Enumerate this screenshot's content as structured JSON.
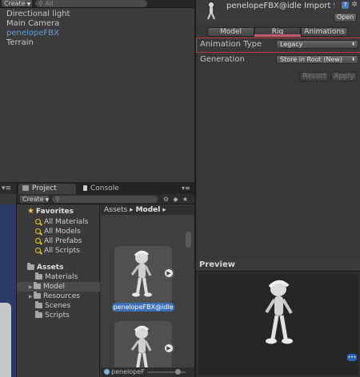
{
  "hierarchy": {
    "create_label": "Create",
    "search_placeholder": "All",
    "items": [
      "Directional light",
      "Main Camera",
      "penelopeFBX",
      "Terrain"
    ]
  },
  "scene": {
    "tab_label": ""
  },
  "project": {
    "tab_project": "Project",
    "tab_console": "Console",
    "create_label": "Create",
    "favorites": {
      "title": "Favorites",
      "items": [
        "All Materials",
        "All Models",
        "All Prefabs",
        "All Scripts"
      ]
    },
    "assets": {
      "title": "Assets",
      "folders": [
        "Materials",
        "Model",
        "Resources",
        "Scenes",
        "Scripts"
      ]
    },
    "breadcrumb": {
      "root": "Assets",
      "sep": "▸",
      "current": "Model",
      "end": "▸"
    },
    "thumbnails": [
      {
        "label": "penelopeFBX@idle"
      },
      {
        "label": ""
      }
    ],
    "bottom_label": "penelopeF"
  },
  "inspector": {
    "title": "penelopeFBX@idle Import Set",
    "open_label": "Open",
    "help_label": "?",
    "tabs": [
      "Model",
      "Rig",
      "Animations"
    ],
    "active_tab": "Rig",
    "animation_type_label": "Animation Type",
    "animation_type_value": "Legacy",
    "generation_label": "Generation",
    "generation_value": "Store in Root (New)",
    "revert_label": "Revert",
    "apply_label": "Apply"
  },
  "preview": {
    "title": "Preview",
    "badge": "•••"
  },
  "colors": {
    "selected_text": "#5b9be8",
    "highlight_box": "#c0383f",
    "rig_underline": "#c25a70",
    "label_selected": "#3d6fb8"
  }
}
